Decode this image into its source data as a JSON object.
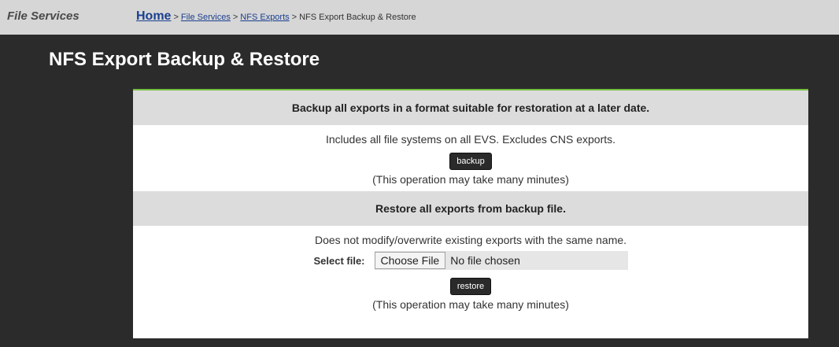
{
  "header": {
    "section": "File Services",
    "breadcrumbs": [
      {
        "label": "Home"
      },
      {
        "label": "File Services"
      },
      {
        "label": "NFS Exports"
      },
      {
        "label": "NFS Export Backup & Restore"
      }
    ],
    "separator": ">"
  },
  "page": {
    "title": "NFS Export Backup & Restore"
  },
  "backup": {
    "heading": "Backup all exports in a format suitable for restoration at a later date.",
    "description": "Includes all file systems on all EVS. Excludes CNS exports.",
    "button_label": "backup",
    "note": "(This operation may take many minutes)"
  },
  "restore": {
    "heading": "Restore all exports from backup file.",
    "description": "Does not modify/overwrite existing exports with the same name.",
    "file_label": "Select file:",
    "choose_file_label": "Choose File",
    "no_file_text": "No file chosen",
    "button_label": "restore",
    "note": "(This operation may take many minutes)"
  },
  "colors": {
    "accent": "#76c043",
    "background": "#2b2b2b",
    "header_bar": "#d6d6d6"
  }
}
